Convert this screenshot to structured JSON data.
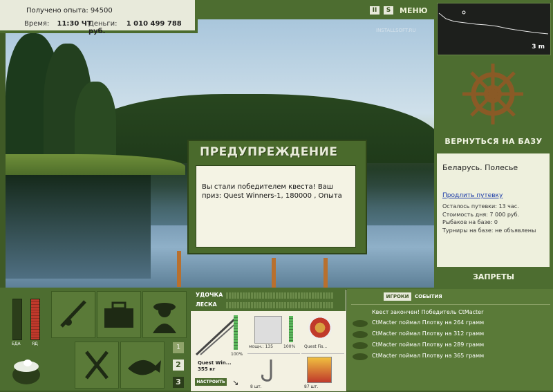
{
  "hud": {
    "exp_label": "Получено опыта:",
    "exp_value": "94500",
    "time_label": "Время:",
    "time_value": "11:30 ЧТ",
    "money_label": "Деньги:",
    "money_value": "1 010 499 788 руб."
  },
  "topbar": {
    "pause": "II",
    "sound": "S",
    "menu": "МЕНЮ"
  },
  "watermark": "INSTALLSOFT.RU",
  "depth": {
    "label": "3 m"
  },
  "right_panel": {
    "back_to_base": "ВЕРНУТЬСЯ НА БАЗУ",
    "location": "Беларусь. Полесье",
    "extend_link": "Продлить путевку",
    "lines": [
      "Осталось путевки: 13 час.",
      "Стоимость дня: 7 000 руб.",
      "Рыбаков на базе: 0",
      "Турниры на базе: не объявлены"
    ],
    "bans": "ЗАПРЕТЫ"
  },
  "dialog": {
    "title": "ПРЕДУПРЕЖДЕНИЕ",
    "message": "Вы стали победителем квеста! Ваш приз: Quest Winners-1, 180000 , Опыта"
  },
  "bars": {
    "food": "ЕДА",
    "poison": "ЯД"
  },
  "slots": [
    "1",
    "2",
    "3"
  ],
  "gear": {
    "rod_label": "УДОЧКА",
    "line_label": "ЛЕСКА",
    "rod_name": "Quest Win...",
    "rod_weight": "355 кг",
    "rod_percent": "100%",
    "setup_button": "НАСТРОИТЬ",
    "reel_label": "мощн.: 135",
    "reel_percent": "100%",
    "line_name": "Quest Fis...",
    "hook_count": "8 шт.",
    "bait_count": "87 шт."
  },
  "tabs": {
    "players": "ИГРОКИ",
    "events": "СОБЫТИЯ"
  },
  "log": {
    "header": "Квест закончен! Победитель CtMacter",
    "entries": [
      "CtMacter поймал Плотву на 264 грамм",
      "CtMacter поймал Плотву на 312 грамм",
      "CtMacter поймал Плотву на 289 грамм",
      "CtMacter поймал Плотву на 365 грамм"
    ]
  },
  "colors": {
    "panel_green": "#4d6d30",
    "panel_light": "#eef0dd",
    "food_bar": "#2b3d1a",
    "poison_bar": "#c0392b"
  }
}
